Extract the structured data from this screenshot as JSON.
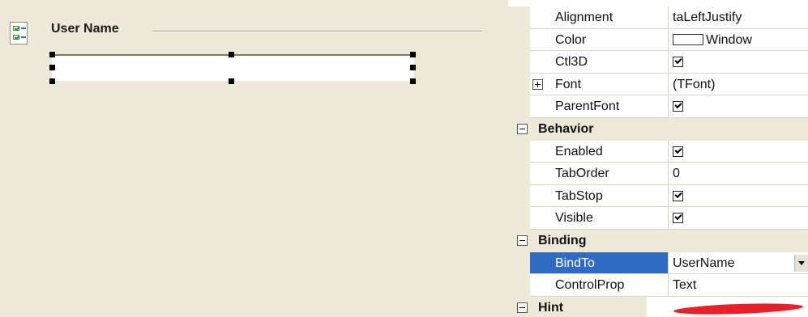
{
  "designer": {
    "group_caption": "User Name",
    "form_icon": "checklist-form-icon"
  },
  "properties": {
    "alignment": {
      "name": "Alignment",
      "value": "taLeftJustify"
    },
    "color": {
      "name": "Color",
      "value": "Window"
    },
    "ctl3d": {
      "name": "Ctl3D",
      "checked": true
    },
    "font": {
      "name": "Font",
      "value": "(TFont)"
    },
    "parentfont": {
      "name": "ParentFont",
      "checked": true
    },
    "behavior": {
      "label": "Behavior"
    },
    "enabled": {
      "name": "Enabled",
      "checked": true
    },
    "taborder": {
      "name": "TabOrder",
      "value": "0"
    },
    "tabstop": {
      "name": "TabStop",
      "checked": true
    },
    "visible": {
      "name": "Visible",
      "checked": true
    },
    "binding": {
      "label": "Binding"
    },
    "bindto": {
      "name": "BindTo",
      "value": "UserName"
    },
    "controlprop": {
      "name": "ControlProp",
      "value": "Text"
    },
    "hint": {
      "label": "Hint"
    }
  },
  "colors": {
    "selection": "#316ac5",
    "annotation": "#e8202a"
  }
}
